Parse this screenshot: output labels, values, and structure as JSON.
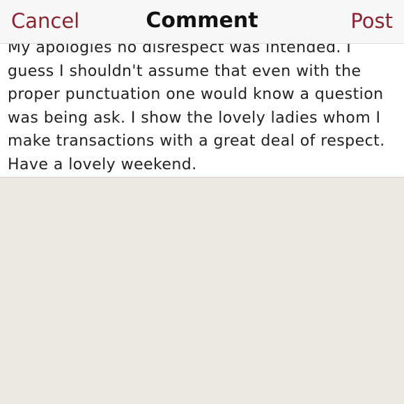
{
  "navbar": {
    "cancel_label": "Cancel",
    "title": "Comment",
    "post_label": "Post",
    "accent_color": "#8c2432"
  },
  "comment": {
    "text": "My apologies no disrespect was intended. I guess I shouldn't assume that even with the proper punctuation one would know a question was being ask. I show the lovely ladies whom I make transactions with a great deal of respect. Have a lovely weekend."
  }
}
